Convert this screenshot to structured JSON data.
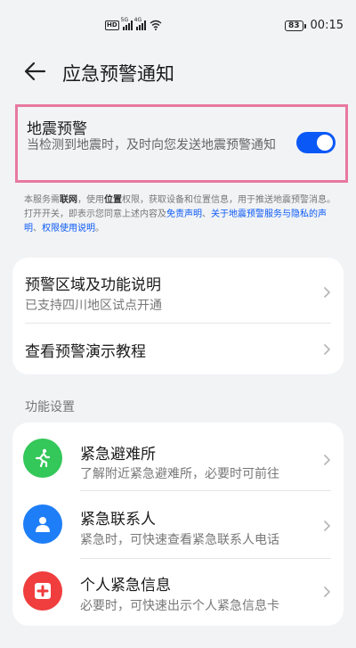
{
  "status": {
    "hd_badge": "HD",
    "signal1_label": "5G",
    "signal2_label": "4G",
    "battery": "83",
    "time": "00:15"
  },
  "header": {
    "title": "应急预警通知"
  },
  "earthquake": {
    "title": "地震预警",
    "description": "当检测到地震时，及时向您发送地震预警通知",
    "toggle_on": true
  },
  "notice": {
    "p1": "本服务需",
    "b1": "联网",
    "p2": "，使用",
    "b2": "位置",
    "p3": "权限，获取设备和位置信息，用于推送地震预警消息。打开开关，即表示您同意上述内容及",
    "l1": "免责声明",
    "p4": "、",
    "l2": "关于地震预警服务与隐私的声明",
    "p5": "、",
    "l3": "权限使用说明",
    "p6": "。"
  },
  "card1": {
    "item1_title": "预警区域及功能说明",
    "item1_sub": "已支持四川地区试点开通",
    "item2_title": "查看预警演示教程"
  },
  "section_label": "功能设置",
  "features": [
    {
      "title": "紧急避难所",
      "sub": "了解附近紧急避难所，必要时可前往",
      "icon": "running-person-icon",
      "color": "#34c759"
    },
    {
      "title": "紧急联系人",
      "sub": "紧急时，可快速查看紧急联系人电话",
      "icon": "person-icon",
      "color": "#1e7ef7"
    },
    {
      "title": "个人紧急信息",
      "sub": "必要时，可快速出示个人紧急信息卡",
      "icon": "medical-cross-icon",
      "color": "#f03d3d"
    }
  ],
  "colors": {
    "accent": "#0a59f7",
    "highlight_border": "#e8799e",
    "background": "#f1f3f5"
  }
}
